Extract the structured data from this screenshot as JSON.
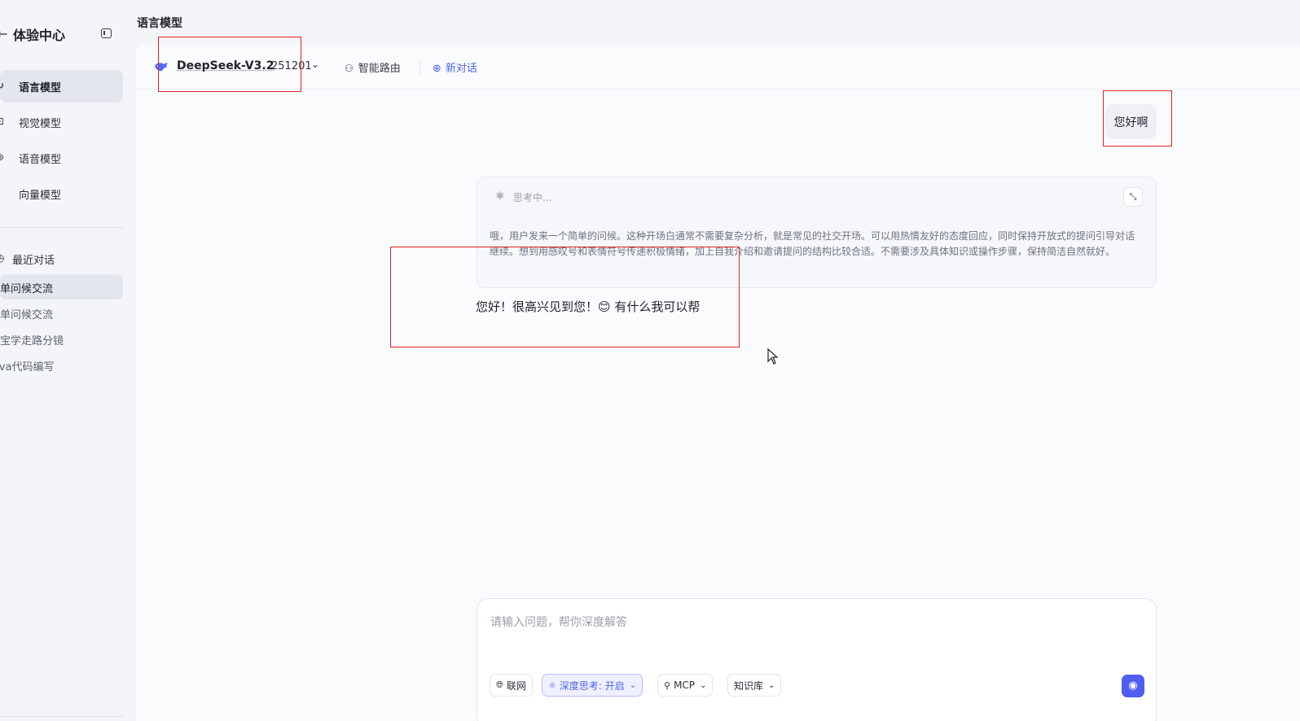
{
  "sidebar": {
    "back_icon": "arrow-left-icon",
    "title": "体验中心",
    "nav": [
      {
        "label": "语言模型",
        "icon": "refresh-icon",
        "glyph": "↻",
        "active": true
      },
      {
        "label": "视觉模型",
        "icon": "image-icon",
        "glyph": "⊡",
        "active": false
      },
      {
        "label": "语音模型",
        "icon": "audio-icon",
        "glyph": "⊛",
        "active": false
      },
      {
        "label": "向量模型",
        "icon": "vector-icon",
        "glyph": "⁝",
        "active": false
      }
    ],
    "recent_label": "最近对话",
    "history": [
      {
        "label": "简单问候交流",
        "active": true
      },
      {
        "label": "简单问候交流",
        "active": false
      },
      {
        "label": "宝宝学走路分镜",
        "active": false
      },
      {
        "label": "Java代码编写",
        "active": false
      }
    ]
  },
  "page_title": "语言模型",
  "toolbar": {
    "model_name": "DeepSeek-V3.2",
    "model_version": "251201",
    "routing_label": "智能路由",
    "new_chat_label": "新对话"
  },
  "chat": {
    "user_message": "您好啊",
    "thinking_title": "思考中...",
    "thinking_text": "哦，用户发来一个简单的问候。这种开场白通常不需要复杂分析，就是常见的社交开场。可以用热情友好的态度回应，同时保持开放式的提问引导对话继续。想到用感叹号和表情符号传递积极情绪，加上自我介绍和邀请提问的结构比较合适。不需要涉及具体知识或操作步骤，保持简洁自然就好。",
    "assistant_message": "您好！很高兴见到您！😊 有什么我可以帮"
  },
  "composer": {
    "placeholder": "请输入问题，帮你深度解答",
    "web_label": "联网",
    "deep_think_label": "深度思考: 开启",
    "mcp_label": "MCP",
    "kb_label": "知识库"
  },
  "colors": {
    "accent": "#4f5ef0",
    "annotation": "#e02424"
  }
}
